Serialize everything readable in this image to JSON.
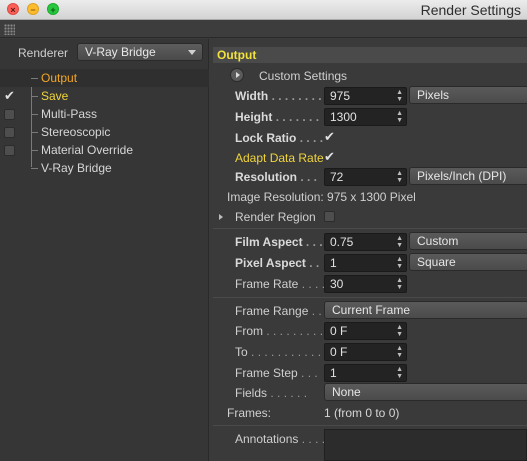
{
  "window": {
    "title": "Render Settings"
  },
  "left": {
    "renderer_label": "Renderer",
    "renderer_value": "V-Ray Bridge",
    "items": [
      {
        "label": "Output",
        "checked": false,
        "has_box": false
      },
      {
        "label": "Save",
        "checked": true,
        "has_box": false
      },
      {
        "label": "Multi-Pass",
        "checked": false,
        "has_box": true
      },
      {
        "label": "Stereoscopic",
        "checked": false,
        "has_box": true
      },
      {
        "label": "Material Override",
        "checked": false,
        "has_box": true
      },
      {
        "label": "V-Ray Bridge",
        "checked": false,
        "has_box": false
      }
    ]
  },
  "right": {
    "section_title": "Output",
    "custom_settings": "Custom Settings",
    "width_label": "Width",
    "width_value": "975",
    "width_unit": "Pixels",
    "height_label": "Height",
    "height_value": "1300",
    "lock_ratio_label": "Lock Ratio",
    "adapt_label": "Adapt Data Rate",
    "resolution_label": "Resolution",
    "resolution_value": "72",
    "resolution_unit": "Pixels/Inch (DPI)",
    "image_resolution": "Image Resolution: 975 x 1300 Pixel",
    "render_region": "Render Region",
    "film_aspect_label": "Film Aspect",
    "film_aspect_value": "0.75",
    "film_aspect_preset": "Custom",
    "pixel_aspect_label": "Pixel Aspect",
    "pixel_aspect_value": "1",
    "pixel_aspect_preset": "Square",
    "frame_rate_label": "Frame Rate",
    "frame_rate_value": "30",
    "frame_range_label": "Frame Range",
    "frame_range_value": "Current Frame",
    "from_label": "From",
    "from_value": "0 F",
    "to_label": "To",
    "to_value": "0 F",
    "frame_step_label": "Frame Step",
    "frame_step_value": "1",
    "fields_label": "Fields",
    "fields_value": "None",
    "frames_label": "Frames:",
    "frames_value": "1 (from 0 to 0)",
    "annotations_label": "Annotations"
  },
  "colors": {
    "accent": "#f5a623",
    "section_title": "#f2e23c"
  }
}
